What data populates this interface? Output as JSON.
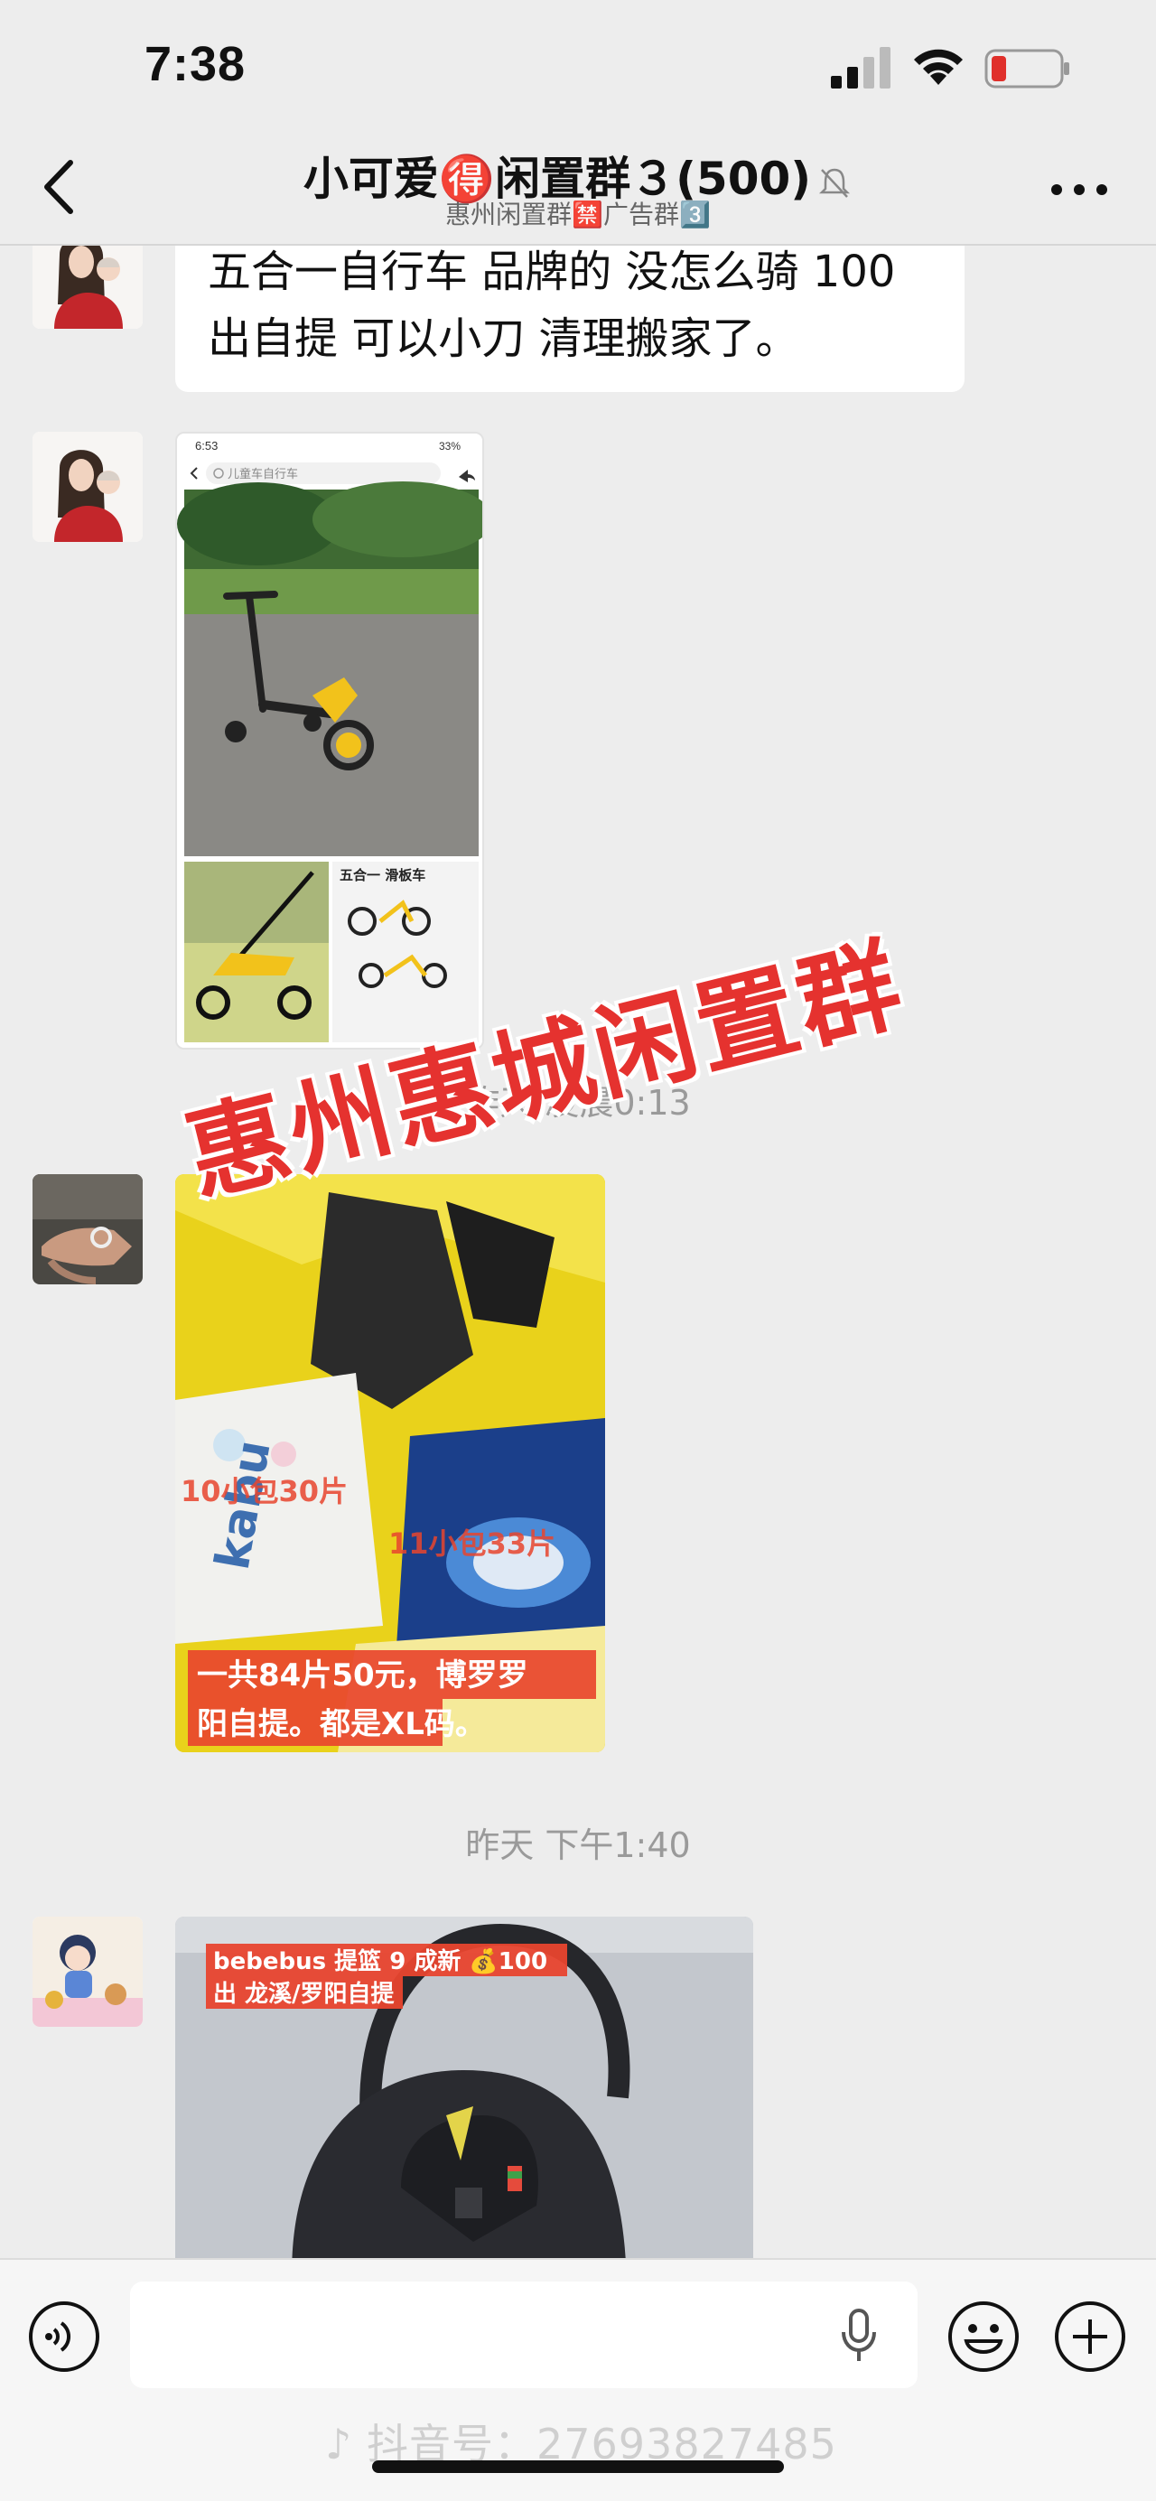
{
  "status_bar": {
    "time": "7:38"
  },
  "nav": {
    "title": "小可爱🉐闲置群３(500)",
    "subtitle": "惠州闲置群🈲广告群3️⃣"
  },
  "messages": {
    "text_1": "五合一自行车 品牌的 没怎么骑 100出自提 可以小刀 清理搬家了。",
    "screenshot": {
      "time": "6:53",
      "battery": "33%",
      "search_text": "儿童车自行车",
      "product_title": "五合一 滑板车"
    },
    "time_1": "昨天 凌晨0:13",
    "diaper_caption_1": "10小包30片",
    "diaper_caption_2": "11小包33片",
    "diaper_caption_3": "一共84片50元，博罗罗阳自提。都是XL码。",
    "diaper_brand": "kabu",
    "time_2": "昨天 下午1:40",
    "carseat_caption": "bebebus 提篮 9 成新 💰100出 龙溪/罗阳自提"
  },
  "watermark": "惠州惠城闲置群",
  "footer": {
    "douyin": "抖音号：27693827485"
  },
  "colors": {
    "bg": "#ededed",
    "bubble": "#ffffff",
    "accent_red": "#e5322f",
    "caption_red": "#e8452e"
  }
}
